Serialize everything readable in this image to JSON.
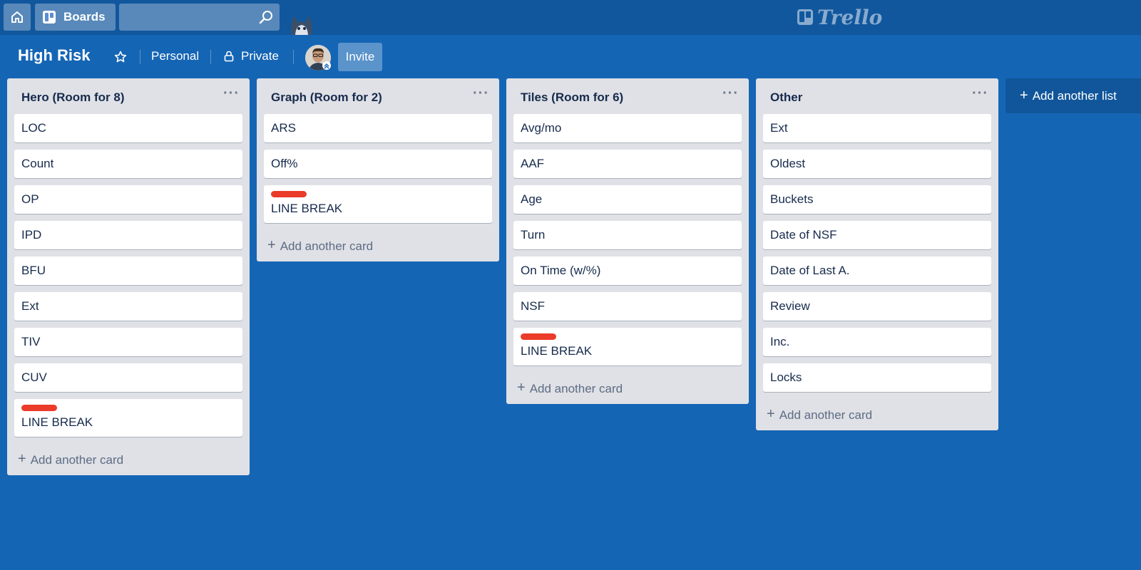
{
  "header": {
    "boards_label": "Boards",
    "logo_text": "Trello"
  },
  "board": {
    "title": "High Risk",
    "team": "Personal",
    "visibility": "Private",
    "invite_label": "Invite"
  },
  "lists": [
    {
      "title": "Hero (Room for 8)",
      "cards": [
        {
          "text": "LOC"
        },
        {
          "text": "Count"
        },
        {
          "text": "OP"
        },
        {
          "text": "IPD"
        },
        {
          "text": "BFU"
        },
        {
          "text": "Ext"
        },
        {
          "text": "TIV"
        },
        {
          "text": "CUV"
        },
        {
          "text": "LINE BREAK",
          "label_color": "#eb3b2a"
        }
      ],
      "add_card_label": "Add another card"
    },
    {
      "title": "Graph (Room for 2)",
      "cards": [
        {
          "text": "ARS"
        },
        {
          "text": "Off%"
        },
        {
          "text": "LINE BREAK",
          "label_color": "#eb3b2a"
        }
      ],
      "add_card_label": "Add another card"
    },
    {
      "title": "Tiles (Room for 6)",
      "cards": [
        {
          "text": "Avg/mo"
        },
        {
          "text": "AAF"
        },
        {
          "text": "Age"
        },
        {
          "text": "Turn"
        },
        {
          "text": "On Time (w/%)"
        },
        {
          "text": "NSF"
        },
        {
          "text": "LINE BREAK",
          "label_color": "#eb3b2a"
        }
      ],
      "add_card_label": "Add another card"
    },
    {
      "title": "Other",
      "cards": [
        {
          "text": "Ext"
        },
        {
          "text": "Oldest"
        },
        {
          "text": "Buckets"
        },
        {
          "text": "Date of NSF"
        },
        {
          "text": "Date of Last A."
        },
        {
          "text": "Review"
        },
        {
          "text": "Inc."
        },
        {
          "text": "Locks"
        }
      ],
      "add_card_label": "Add another card"
    }
  ],
  "add_list_label": "Add another list",
  "colors": {
    "board_bg": "#1565b5",
    "header_bg": "#11579d",
    "list_bg": "#dfe1e6",
    "label_red": "#eb3b2a"
  }
}
